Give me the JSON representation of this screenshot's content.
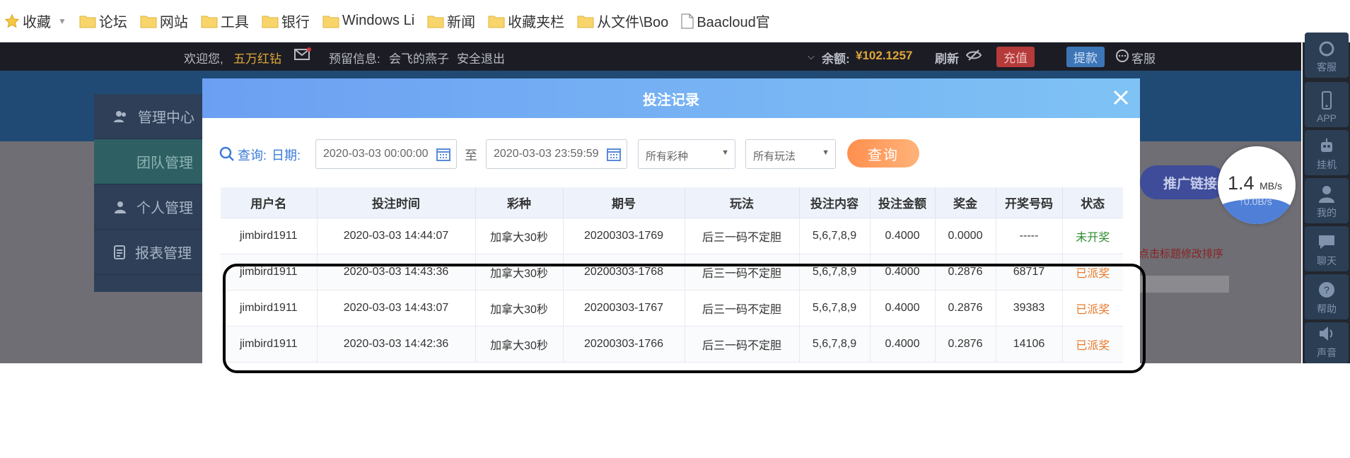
{
  "bookmarks": [
    {
      "label": "收藏",
      "icon": "star-icon"
    },
    {
      "label": "论坛",
      "icon": "folder-icon"
    },
    {
      "label": "网站",
      "icon": "folder-icon"
    },
    {
      "label": "工具",
      "icon": "folder-icon"
    },
    {
      "label": "银行",
      "icon": "folder-icon"
    },
    {
      "label": "Windows Li",
      "icon": "folder-icon"
    },
    {
      "label": "新闻",
      "icon": "folder-icon"
    },
    {
      "label": "收藏夹栏",
      "icon": "folder-icon"
    },
    {
      "label": "从文件\\Boo",
      "icon": "folder-icon"
    },
    {
      "label": "Baacloud官",
      "icon": "page-icon"
    }
  ],
  "topbar": {
    "welcome": "欢迎您,",
    "username": "五万红钻",
    "reserved_label": "预留信息:",
    "reserved_value": "会飞的燕子",
    "logout": "安全退出",
    "balance_label": "余额:",
    "balance_value": "¥102.1257",
    "refresh": "刷新",
    "recharge": "充值",
    "withdraw": "提款",
    "service": "客服"
  },
  "sidebar": {
    "items": [
      {
        "label": "管理中心"
      },
      {
        "label": "团队管理"
      },
      {
        "label": "个人管理"
      },
      {
        "label": "报表管理"
      }
    ]
  },
  "background": {
    "promo_link": "推广链接",
    "sort_hint": "点击标题修改排序"
  },
  "rail": {
    "items": [
      {
        "label": "客服"
      },
      {
        "label": "APP"
      },
      {
        "label": "挂机"
      },
      {
        "label": "我的"
      },
      {
        "label": "聊天"
      },
      {
        "label": "帮助"
      },
      {
        "label": "声音"
      }
    ]
  },
  "speed": {
    "value": "1.4",
    "unit": "MB/s",
    "upload": "↑0.0B/s"
  },
  "modal": {
    "title": "投注记录",
    "query_label": "查询:",
    "date_label": "日期:",
    "start_date": "2020-03-03 00:00:00",
    "to_label": "至",
    "end_date": "2020-03-03 23:59:59",
    "lottery_select": "所有彩种",
    "play_select": "所有玩法",
    "query_button": "查询",
    "columns": [
      "用户名",
      "投注时间",
      "彩种",
      "期号",
      "玩法",
      "投注内容",
      "投注金额",
      "奖金",
      "开奖号码",
      "状态"
    ],
    "rows": [
      [
        "jimbird1911",
        "2020-03-03 14:44:07",
        "加拿大30秒",
        "20200303-1769",
        "后三一码不定胆",
        "5,6,7,8,9",
        "0.4000",
        "0.0000",
        "-----",
        "未开奖"
      ],
      [
        "jimbird1911",
        "2020-03-03 14:43:36",
        "加拿大30秒",
        "20200303-1768",
        "后三一码不定胆",
        "5,6,7,8,9",
        "0.4000",
        "0.2876",
        "68717",
        "已派奖"
      ],
      [
        "jimbird1911",
        "2020-03-03 14:43:07",
        "加拿大30秒",
        "20200303-1767",
        "后三一码不定胆",
        "5,6,7,8,9",
        "0.4000",
        "0.2876",
        "39383",
        "已派奖"
      ],
      [
        "jimbird1911",
        "2020-03-03 14:42:36",
        "加拿大30秒",
        "20200303-1766",
        "后三一码不定胆",
        "5,6,7,8,9",
        "0.4000",
        "0.2876",
        "14106",
        "已派奖"
      ]
    ],
    "status_colors": {
      "未开奖": "#2e8b2e",
      "已派奖": "#e8792a"
    }
  }
}
